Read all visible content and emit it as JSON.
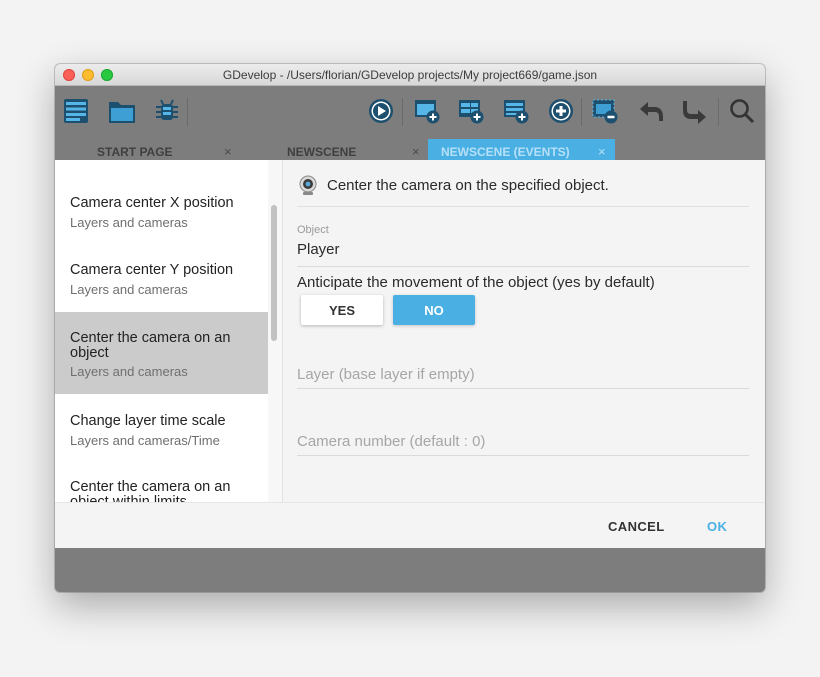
{
  "window": {
    "title": "GDevelop - /Users/florian/GDevelop projects/My project669/game.json"
  },
  "toolbar": {
    "icons": [
      "project-manager-icon",
      "open-folder-icon",
      "debugger-bug-icon",
      "preview-play-icon",
      "add-scene-icon",
      "add-external-events-icon",
      "add-external-layout-icon",
      "add-event-icon",
      "delete-icon",
      "undo-icon",
      "redo-icon",
      "search-icon"
    ]
  },
  "tabs": [
    {
      "label": "START PAGE",
      "close": "×",
      "active": false
    },
    {
      "label": "NEWSCENE",
      "close": "×",
      "active": false
    },
    {
      "label": "NEWSCENE (EVENTS)",
      "close": "×",
      "active": true
    }
  ],
  "instruction_list": [
    {
      "title": "Camera center X position",
      "subtitle": "Layers and cameras"
    },
    {
      "title": "Camera center Y position",
      "subtitle": "Layers and cameras"
    },
    {
      "title": "Center the camera on an object",
      "subtitle": "Layers and cameras",
      "selected": true
    },
    {
      "title": "Change layer time scale",
      "subtitle": "Layers and cameras/Time"
    },
    {
      "title": "Center the camera on an object within limits",
      "subtitle": ""
    }
  ],
  "form": {
    "description": "Center the camera on the specified object.",
    "object_label": "Object",
    "object_value": "Player",
    "anticipate_label": "Anticipate the movement of the object (yes by default)",
    "yes_label": "YES",
    "no_label": "NO",
    "layer_placeholder": "Layer (base layer if empty)",
    "camera_placeholder": "Camera number (default : 0)"
  },
  "actions": {
    "cancel_label": "CANCEL",
    "ok_label": "OK"
  },
  "colors": {
    "accent": "#4ab0e4",
    "toolbar_bg": "#7d7d7d",
    "selected_item": "#cbcbcb"
  }
}
